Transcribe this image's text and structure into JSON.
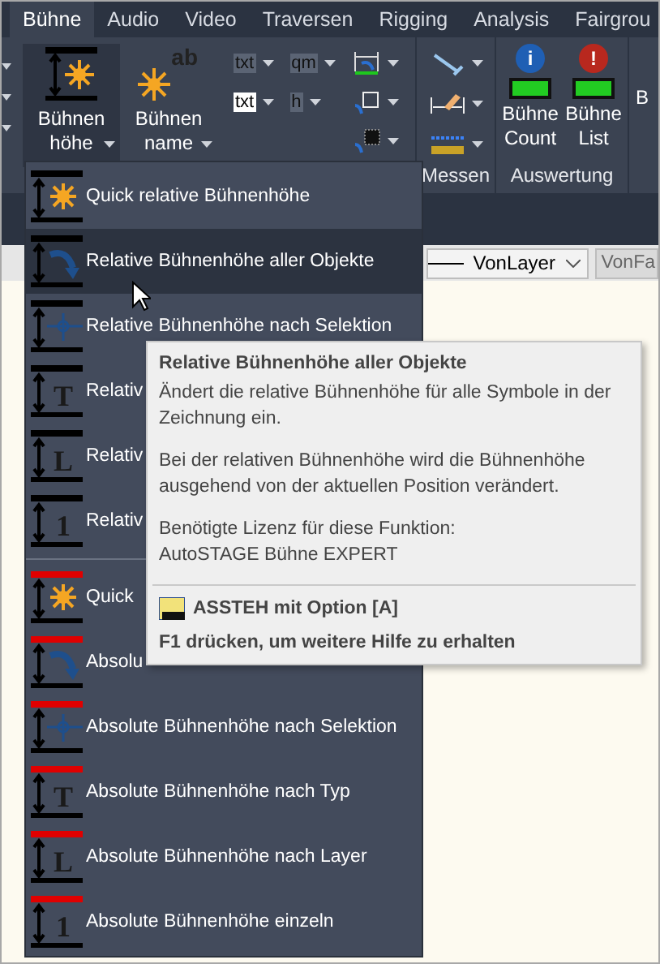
{
  "tabs": [
    {
      "label": "Bühne",
      "selected": true
    },
    {
      "label": "Audio",
      "selected": false
    },
    {
      "label": "Video",
      "selected": false
    },
    {
      "label": "Traversen",
      "selected": false
    },
    {
      "label": "Rigging",
      "selected": false
    },
    {
      "label": "Analysis",
      "selected": false
    },
    {
      "label": "Fairgrou",
      "selected": false
    }
  ],
  "ribbon": {
    "large_buttons": [
      {
        "label": "Bühnen höhe",
        "pressed": true
      },
      {
        "label": "Bühnen name",
        "icon_text": "ab",
        "pressed": false
      }
    ],
    "small_tools": [
      [
        {
          "kind": "text",
          "label": "txt"
        },
        {
          "kind": "text-boxed",
          "label": "txt"
        }
      ],
      [
        {
          "kind": "text",
          "label": "qm"
        },
        {
          "kind": "text",
          "label": "h"
        }
      ],
      [
        {
          "kind": "dimension"
        },
        {
          "kind": "square"
        },
        {
          "kind": "grid"
        }
      ]
    ],
    "measure_group": {
      "label": "Messen",
      "tools": [
        {
          "kind": "measure-line"
        },
        {
          "kind": "pencil-dimension"
        },
        {
          "kind": "ruler"
        }
      ]
    },
    "evaluation_group": {
      "label": "Auswertung",
      "buttons": [
        {
          "label": "Bühne Count",
          "badge": "i",
          "color": "#1f5fb4"
        },
        {
          "label": "Bühne List",
          "badge": "!",
          "color": "#b8281e"
        }
      ]
    },
    "cut_button": {
      "label": "B"
    }
  },
  "properties_bar": {
    "linetype": "VonLayer",
    "color_button": "VonFa"
  },
  "menu": {
    "items": [
      {
        "label": "Quick relative Bühnenhöhe",
        "kind": "quick",
        "color": "#000000",
        "selected": false
      },
      {
        "label": "Relative Bühnenhöhe aller Objekte",
        "kind": "arrow",
        "color": "#000000",
        "selected": true
      },
      {
        "label": "Relative Bühnenhöhe nach Selektion",
        "kind": "cross",
        "color": "#000000",
        "selected": false
      },
      {
        "label": "Relativ",
        "kind": "letter",
        "glyph": "T",
        "color": "#000000",
        "selected": false
      },
      {
        "label": "Relativ",
        "kind": "letter",
        "glyph": "L",
        "color": "#000000",
        "selected": false
      },
      {
        "label": "Relativ",
        "kind": "letter",
        "glyph": "1",
        "color": "#000000",
        "selected": false
      },
      {
        "label": "Quick",
        "kind": "quick",
        "color": "#e00000",
        "selected": false
      },
      {
        "label": "Absolu",
        "kind": "arrow",
        "color": "#e00000",
        "selected": false
      },
      {
        "label": "Absolute Bühnenhöhe nach Selektion",
        "kind": "cross",
        "color": "#e00000",
        "selected": false
      },
      {
        "label": "Absolute Bühnenhöhe nach Typ",
        "kind": "letter",
        "glyph": "T",
        "color": "#e00000",
        "selected": false
      },
      {
        "label": "Absolute Bühnenhöhe nach Layer",
        "kind": "letter",
        "glyph": "L",
        "color": "#e00000",
        "selected": false
      },
      {
        "label": "Absolute Bühnenhöhe einzeln",
        "kind": "letter",
        "glyph": "1",
        "color": "#e00000",
        "selected": false
      }
    ]
  },
  "tooltip": {
    "title": "Relative Bühnenhöhe aller Objekte",
    "paragraphs": [
      [
        "Ändert die relative Bühnenhöhe für alle Symbole in der",
        "Zeichnung ein."
      ],
      [
        "Bei der relativen Bühnenhöhe wird die Bühnenhöhe",
        "ausgehend von der aktuellen Position verändert."
      ],
      [
        "Benötigte Lizenz für diese Funktion:",
        "AutoSTAGE Bühne EXPERT"
      ]
    ],
    "command": "ASSTEH mit Option [A]",
    "help": "F1 drücken, um weitere Hilfe zu erhalten"
  }
}
